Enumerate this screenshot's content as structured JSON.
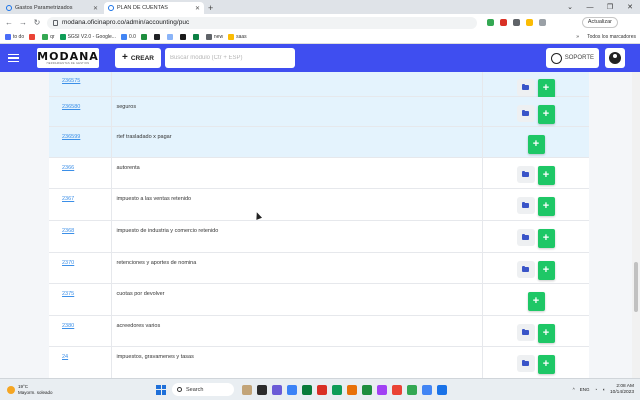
{
  "browser": {
    "tabs": [
      {
        "title": "Gastos Parametrizados"
      },
      {
        "title": "PLAN DE CUENTAS"
      }
    ],
    "new_tab": "+",
    "window_controls": [
      "⌄",
      "—",
      "❐",
      "✕"
    ],
    "url": "modana.oficinapro.co/admin/accounting/puc",
    "update_label": "Actualizar",
    "bookmarks": [
      {
        "label": "to do",
        "color": "#4a6cf7"
      },
      {
        "label": "",
        "color": "#ea4335"
      },
      {
        "label": "qr",
        "color": "#34a853"
      },
      {
        "label": "SGSI V2.0 - Google...",
        "color": "#0f9d58"
      },
      {
        "label": "0.0",
        "color": "#4285f4"
      },
      {
        "label": "",
        "color": "#1e8e3e"
      },
      {
        "label": "",
        "color": "#202124"
      },
      {
        "label": "",
        "color": "#8ab4f8"
      },
      {
        "label": "",
        "color": "#1a1a1a"
      },
      {
        "label": "",
        "color": "#0b8043"
      },
      {
        "label": "new",
        "color": "#5f6368"
      },
      {
        "label": "saas",
        "color": "#fbbc04"
      }
    ],
    "all_bookmarks": "Todos los marcadores"
  },
  "app": {
    "logo_main": "MODANA",
    "logo_sub": "HERRAMIENTAS DE GESTION",
    "create_label": "CREAR",
    "search_placeholder": "Buscar módulo (Ctr + ESP)",
    "support_label": "SOPORTE"
  },
  "accounts": {
    "rows": [
      {
        "code": "236575",
        "name": "",
        "has_folder": true,
        "selected": true
      },
      {
        "code": "236580",
        "name": "seguros",
        "has_folder": true,
        "selected": true
      },
      {
        "code": "236599",
        "name": "rtef trasladado x pagar",
        "has_folder": false,
        "selected": true
      },
      {
        "code": "2366",
        "name": "autorenta",
        "has_folder": true,
        "selected": false
      },
      {
        "code": "2367",
        "name": "impuesto a las ventas retenido",
        "has_folder": true,
        "selected": false
      },
      {
        "code": "2368",
        "name": "impuesto de industria y comercio retenido",
        "has_folder": true,
        "selected": false
      },
      {
        "code": "2370",
        "name": "retenciones y aportes de nomina",
        "has_folder": true,
        "selected": false
      },
      {
        "code": "2375",
        "name": "cuotas por devolver",
        "has_folder": false,
        "selected": false
      },
      {
        "code": "2380",
        "name": "acreedores varios",
        "has_folder": true,
        "selected": false
      },
      {
        "code": "24",
        "name": "impuestos, gravamenes y tasas",
        "has_folder": true,
        "selected": false
      }
    ],
    "add_symbol": "+"
  },
  "taskbar": {
    "temp": "19°C",
    "weather": "Mayorm. soleado",
    "search_label": "Search",
    "lang": "ENG",
    "time": "2:08 AM",
    "date": "10/14/2023",
    "app_colors": [
      "#c2a478",
      "#2c2c2c",
      "#6b5bd6",
      "#3b82f6",
      "#0a7c3a",
      "#d93025",
      "#0f9d58",
      "#e8710a",
      "#1e8e3e",
      "#a142f4",
      "#ea4335",
      "#34a853",
      "#4285f4",
      "#1a73e8"
    ]
  }
}
